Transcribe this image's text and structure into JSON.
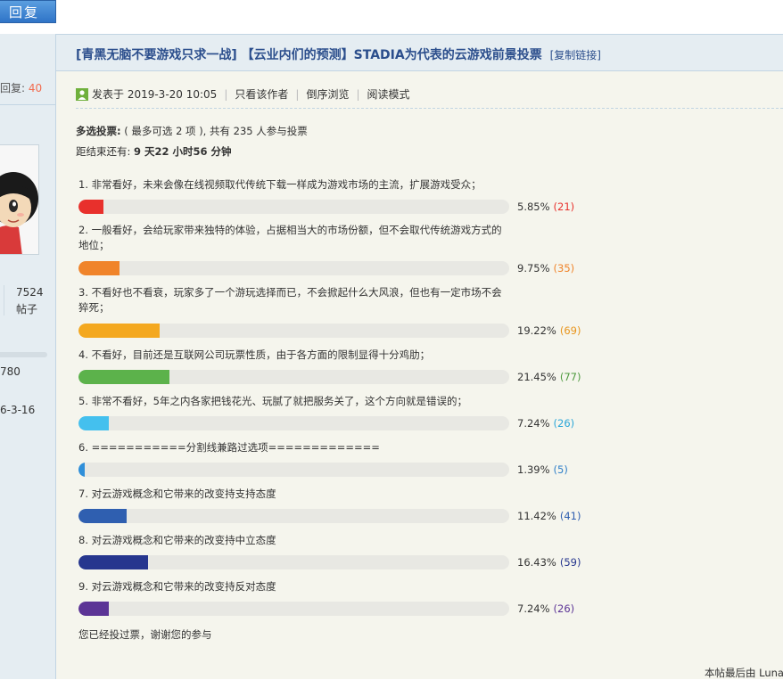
{
  "toolbar": {
    "reply_label": "回复"
  },
  "sidebar": {
    "reply_label": "回复:",
    "reply_count": "40",
    "posts_count": "7524",
    "posts_label": "帖子",
    "info_line1": "780",
    "info_line2": "6-3-16"
  },
  "post": {
    "title": "[青黑无脑不要游戏只求一战] 【云业内们的预测】STADIA为代表的云游戏前景投票",
    "copy_link": "[复制链接]",
    "posted": "发表于 2019-3-20 10:05",
    "only_author": "只看该作者",
    "reverse_order": "倒序浏览",
    "read_mode": "阅读模式",
    "last_edit": "本帖最后由 Luna"
  },
  "poll": {
    "type_label": "多选投票:",
    "summary": "( 最多可选 2 项 ), 共有 235 人参与投票",
    "remaining_label": "距结束还有:",
    "remaining_value": "9 天22 小时56 分钟",
    "voted_note": "您已经投过票，谢谢您的参与",
    "options": [
      {
        "text": "1.  非常看好，未来会像在线视频取代传统下载一样成为游戏市场的主流，扩展游戏受众；",
        "percent": "5.85%",
        "count": "(21)",
        "fraction": 0.0585,
        "color": "#e8302c",
        "count_color": "#e8302c"
      },
      {
        "text": "2.  一般看好，会给玩家带来独特的体验，占据相当大的市场份额，但不会取代传统游戏方式的地位；",
        "percent": "9.75%",
        "count": "(35)",
        "fraction": 0.0975,
        "color": "#f0842a",
        "count_color": "#f0842a"
      },
      {
        "text": "3.  不看好也不看衰，玩家多了一个游玩选择而已，不会掀起什么大风浪，但也有一定市场不会猝死；",
        "percent": "19.22%",
        "count": "(69)",
        "fraction": 0.1922,
        "color": "#f4a81f",
        "count_color": "#e8951c"
      },
      {
        "text": "4.  不看好，目前还是互联网公司玩票性质，由于各方面的限制显得十分鸡肋；",
        "percent": "21.45%",
        "count": "(77)",
        "fraction": 0.2145,
        "color": "#5cb24b",
        "count_color": "#4f9a3f"
      },
      {
        "text": "5.  非常不看好，5年之内各家把钱花光、玩腻了就把服务关了，这个方向就是错误的；",
        "percent": "7.24%",
        "count": "(26)",
        "fraction": 0.0724,
        "color": "#44c0ee",
        "count_color": "#2aa6d8"
      },
      {
        "text": "6.  ===========分割线兼路过选项=============",
        "percent": "1.39%",
        "count": "(5)",
        "fraction": 0.0139,
        "color": "#2f8fd9",
        "count_color": "#2f7fc9"
      },
      {
        "text": "7.  对云游戏概念和它带来的改变持支持态度",
        "percent": "11.42%",
        "count": "(41)",
        "fraction": 0.1142,
        "color": "#2f5fb0",
        "count_color": "#2f5fb0"
      },
      {
        "text": "8.  对云游戏概念和它带来的改变持中立态度",
        "percent": "16.43%",
        "count": "(59)",
        "fraction": 0.1643,
        "color": "#26368e",
        "count_color": "#26368e"
      },
      {
        "text": "9.  对云游戏概念和它带来的改变持反对态度",
        "percent": "7.24%",
        "count": "(26)",
        "fraction": 0.0724,
        "color": "#5c3496",
        "count_color": "#5c3496"
      }
    ]
  }
}
